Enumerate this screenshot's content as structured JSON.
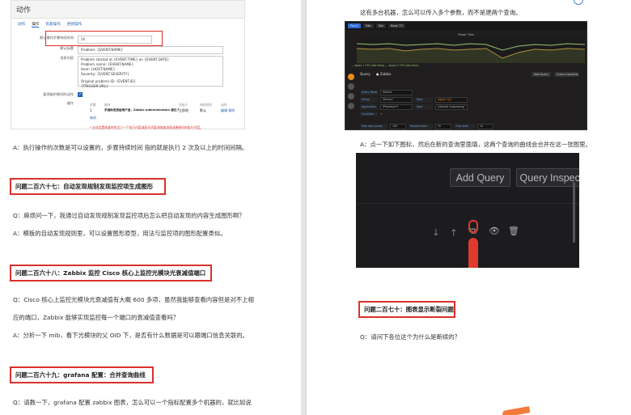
{
  "left": {
    "zabbix": {
      "title": "动作",
      "tabs": [
        "动作",
        "操作",
        "恢复操作",
        "更新操作"
      ],
      "rows": [
        {
          "label": "默认操作步骤持续时间",
          "value": "1h"
        },
        {
          "label": "默认标题",
          "value": "Problem: {EVENT.NAME}"
        }
      ],
      "message_label": "消息内容",
      "message_lines": [
        "Problem started at {EVENT.TIME} on {EVENT.DATE}",
        "Problem name: {EVENT.NAME}",
        "Host: {HOST.NAME}",
        "Severity: {EVENT.SEVERITY}",
        "",
        "Original problem ID: {EVENT.ID}",
        "{TRIGGER.URL}"
      ],
      "pause_label": "暂停维护期间的动作",
      "ops_label": "操作",
      "ops_headers": [
        "步骤",
        "细节",
        "开始于",
        "持续时间",
        "动作"
      ],
      "op_row": [
        "1",
        "手指标发送给用户组：Zabbix administrators 通过 所有媒介",
        "立即地",
        "默认",
        "编辑 移除"
      ],
      "new_link": "新的",
      "note": "* 必须设置恢复时的至少一个执行内容或执行内容或恢复消息或更新时的执行内容。"
    },
    "answer1": "A：执行操作的次数是可以设置的，步骤持续时间 指的就是执行 2 次及以上的时间间隔。",
    "q267": "问题二百六十七：自动发现规制发现监控项生成图形",
    "q267_q": "Q：麻烦问一下，我通过自动发现规制发现监控项后怎么把自动发现的内容生成图形啊？",
    "q267_a": "A：模板的自动发现规则里，可以设置图形原型，用法与监控项的图形配置类似。",
    "q268": "问题二百六十八：Zabbix 监控 Cisco 核心上监控光模块光衰减值端口",
    "q268_q1": "Q：Cisco 核心上监控光模块光衰减值有大概 600 多项，虽然我能够查看内容但是对不上相",
    "q268_q2": "应的端口，Zabbix 能够实现监控每一个端口的衰减值查看吗？",
    "q268_a": "A：分析一下 mib，看下光模块的父 OID 下，是否有什么数据是可以跟端口信息关联的。",
    "q269": "问题二百六十九：grafana 配置：合并查询曲线",
    "q269_q": "Q：请教一下，grafana 配置 zabbix 图表，怎么可以一个指标配置多个机器的，就比如说"
  },
  "right": {
    "intro": "这有多台机器，怎么可以传入多个参数，而不是建两个查询。",
    "grafana": {
      "tabs": [
        "Panel",
        "Edit",
        "Tab",
        "Kiosk TV"
      ],
      "panel_title": "Panel Title",
      "legend": "— Apple 1 CPU (idle time)  — Apple 2 CPU (idle time)",
      "query_label": "Query",
      "datasource": "Zabbix",
      "btn_add": "Add Query",
      "btn_inspect": "Query Inspector",
      "form": [
        [
          "Query Mode",
          "Metrics",
          "",
          ""
        ],
        [
          "Group",
          "/Server/",
          "Host",
          "/Apple 1|2/"
        ],
        [
          "Application",
          "/Prozessor*/",
          "Item",
          "/(Speed) Auslastung/"
        ],
        [
          "Functions",
          "+",
          "",
          ""
        ]
      ],
      "bottom": [
        [
          "Max data points",
          "100"
        ],
        [
          "Relative time",
          "1h"
        ],
        [
          "Time shift",
          "1h"
        ]
      ]
    },
    "answer2": "A：点一下如下图标，然后在新的查询里面填，这两个查询的曲线会合并在这一张图里。",
    "toolbar": {
      "add_query": "Add Query",
      "query_inspector": "Query Inspector",
      "help": "?"
    },
    "q270": "问题二百七十：图表显示断裂问题",
    "q270_q": "Q：请问下各位这个为什么是断续的？"
  }
}
